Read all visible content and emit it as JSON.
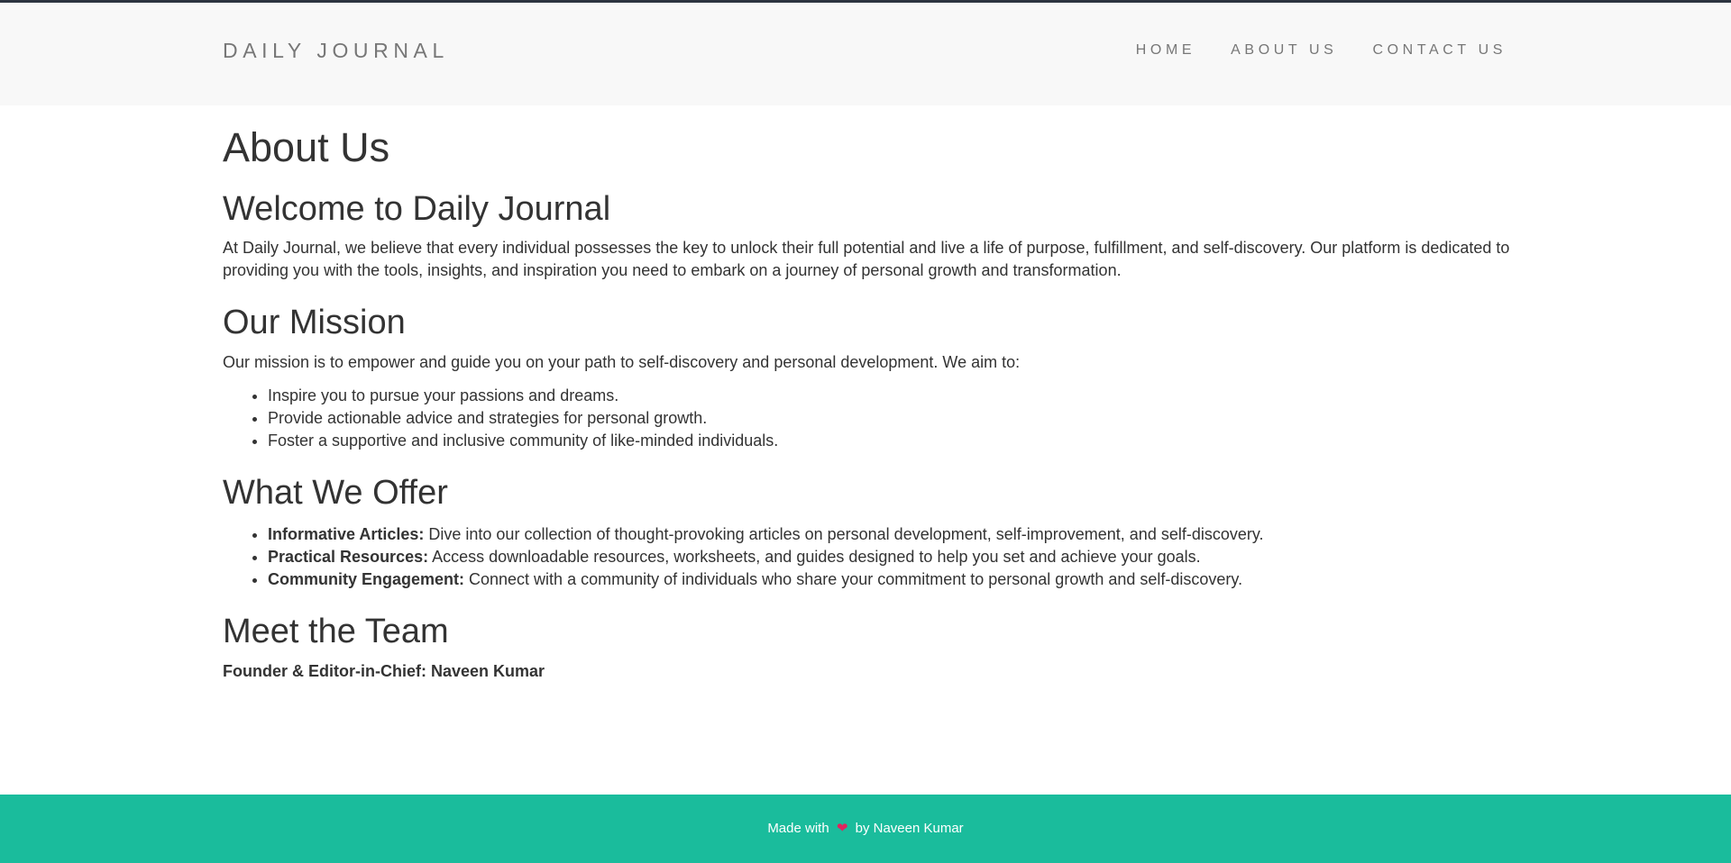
{
  "header": {
    "brand": "DAILY JOURNAL",
    "nav": [
      "HOME",
      "ABOUT US",
      "CONTACT US"
    ]
  },
  "page": {
    "title": "About Us",
    "welcome": {
      "heading": "Welcome to Daily Journal",
      "text": "At Daily Journal, we believe that every individual possesses the key to unlock their full potential and live a life of purpose, fulfillment, and self-discovery. Our platform is dedicated to providing you with the tools, insights, and inspiration you need to embark on a journey of personal growth and transformation."
    },
    "mission": {
      "heading": "Our Mission",
      "intro": "Our mission is to empower and guide you on your path to self-discovery and personal development. We aim to:",
      "items": [
        "Inspire you to pursue your passions and dreams.",
        "Provide actionable advice and strategies for personal growth.",
        "Foster a supportive and inclusive community of like-minded individuals."
      ]
    },
    "offer": {
      "heading": "What We Offer",
      "items": [
        {
          "label": "Informative Articles:",
          "text": " Dive into our collection of thought-provoking articles on personal development, self-improvement, and self-discovery."
        },
        {
          "label": "Practical Resources:",
          "text": " Access downloadable resources, worksheets, and guides designed to help you set and achieve your goals."
        },
        {
          "label": "Community Engagement:",
          "text": " Connect with a community of individuals who share your commitment to personal growth and self-discovery."
        }
      ]
    },
    "team": {
      "heading": "Meet the Team",
      "founder": "Founder & Editor-in-Chief: Naveen Kumar"
    }
  },
  "footer": {
    "prefix": "Made with",
    "heart_icon": "heart-icon",
    "suffix": "by Naveen Kumar",
    "heart_color": "#e0245e",
    "background": "#1abc9c"
  }
}
